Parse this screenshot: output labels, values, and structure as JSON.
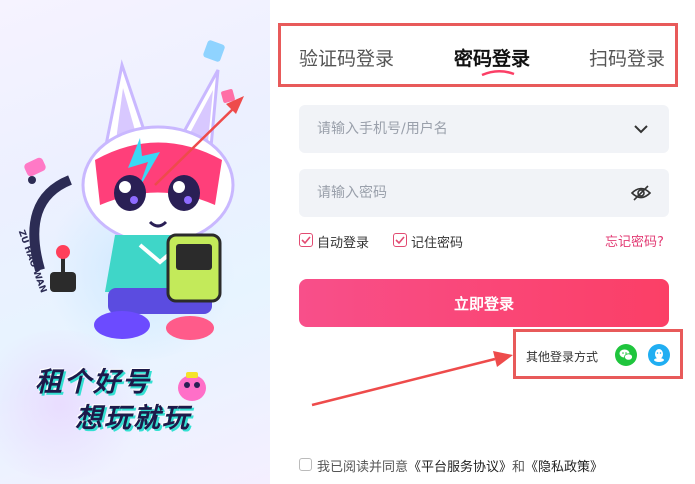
{
  "promo": {
    "badge_text": "ZU HAO WAN",
    "slogan_line1": "租个好号",
    "slogan_line2": "想玩就玩"
  },
  "tabs": [
    {
      "label": "验证码登录",
      "active": false
    },
    {
      "label": "密码登录",
      "active": true
    },
    {
      "label": "扫码登录",
      "active": false
    }
  ],
  "form": {
    "account_placeholder": "请输入手机号/用户名",
    "password_placeholder": "请输入密码",
    "auto_login_label": "自动登录",
    "auto_login_checked": true,
    "remember_label": "记住密码",
    "remember_checked": true,
    "forgot_label": "忘记密码?",
    "submit_label": "立即登录"
  },
  "other_login": {
    "label": "其他登录方式",
    "icons": [
      "wechat-icon",
      "qq-icon"
    ]
  },
  "agreement": {
    "prefix": "我已阅读并同意",
    "service_link": "《平台服务协议》",
    "and_text": "和",
    "privacy_link": "《隐私政策》",
    "checked": false
  },
  "colors": {
    "accent": "#fb3f66",
    "highlight_box": "#e85a5a",
    "wechat": "#1fc53d",
    "qq": "#20aef2"
  }
}
